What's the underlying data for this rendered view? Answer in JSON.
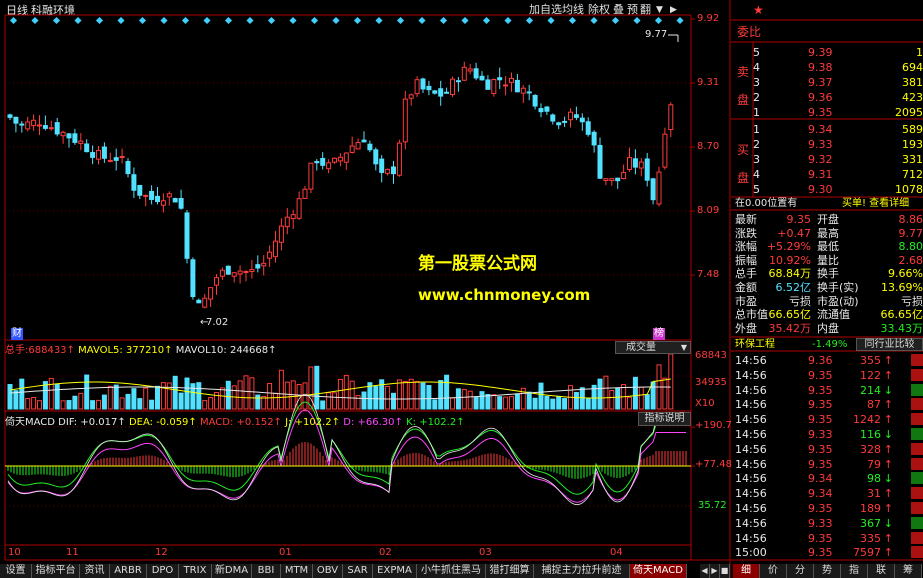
{
  "chart_header": {
    "period": "日线",
    "stock_name": "科融环境"
  },
  "toolbar": {
    "buttons": [
      "加自选",
      "均线",
      "除权",
      "叠",
      "预",
      "翻"
    ],
    "arrow_down": "▼",
    "arrow_right": "▶"
  },
  "price_axis": [
    "9.92",
    "9.31",
    "8.70",
    "8.09",
    "7.48"
  ],
  "marks": {
    "high": "9.77",
    "low": "7.02",
    "cai_badge": "财",
    "tan_badge": "榜"
  },
  "watermark": {
    "line1": "第一股票公式网",
    "line2": "www.chnmoney.com"
  },
  "volume_header": {
    "label": "总手:",
    "value": "688433↑",
    "ma5_label": "MAVOL5:",
    "ma5": "377210↑",
    "ma10_label": "MAVOL10:",
    "ma10": "244668↑",
    "select": "成交量",
    "select_arrow": "▼"
  },
  "volume_axis": [
    "68843",
    "34935",
    "X10"
  ],
  "macd_header": {
    "name": "倚天MACD",
    "dif_label": "DIF:",
    "dif": "+0.017↑",
    "dea_label": "DEA:",
    "dea": "-0.059↑",
    "macd_label": "MACD:",
    "macd": "+0.152↑",
    "j_label": "J:",
    "j": "+102.2↑",
    "d_label": "D:",
    "d": "+66.30↑",
    "k_label": "K:",
    "k": "+102.2↑",
    "help": "指标说明"
  },
  "macd_axis": [
    "+190.7",
    "+77.48",
    "35.72"
  ],
  "date_axis": [
    "10",
    "11",
    "12",
    "01",
    "02",
    "03",
    "04"
  ],
  "bottom_tabs": [
    "设置",
    "指标平台",
    "资讯",
    "ARBR",
    "DPO",
    "TRIX",
    "新DMA",
    "BBI",
    "MTM",
    "OBV",
    "SAR",
    "EXPMA",
    "小牛抓住黑马",
    "猎打细算",
    "捕捉主力拉升前迹",
    "倚天MACD"
  ],
  "bottom_nav": [
    "◀",
    "▶",
    "■"
  ],
  "right_tabs": [
    "细",
    "价",
    "分",
    "势",
    "指",
    "联",
    "筹"
  ],
  "order_book": {
    "title": "委比",
    "sell_label": "卖盘",
    "buy_label": "买盘",
    "asks": [
      {
        "level": "5",
        "price": "9.39",
        "vol": "1"
      },
      {
        "level": "4",
        "price": "9.38",
        "vol": "694"
      },
      {
        "level": "3",
        "price": "9.37",
        "vol": "381"
      },
      {
        "level": "2",
        "price": "9.36",
        "vol": "423"
      },
      {
        "level": "1",
        "price": "9.35",
        "vol": "2095"
      }
    ],
    "bids": [
      {
        "level": "1",
        "price": "9.34",
        "vol": "589"
      },
      {
        "level": "2",
        "price": "9.33",
        "vol": "193"
      },
      {
        "level": "3",
        "price": "9.32",
        "vol": "331"
      },
      {
        "level": "4",
        "price": "9.31",
        "vol": "712"
      },
      {
        "level": "5",
        "price": "9.30",
        "vol": "1078"
      }
    ]
  },
  "position_bar": {
    "left": "在0.00位置有",
    "right": "买单! 查看详细"
  },
  "quote": [
    {
      "l1": "最新",
      "v1": "9.35",
      "l2": "开盘",
      "v2": "8.86"
    },
    {
      "l1": "涨跌",
      "v1": "+0.47",
      "l2": "最高",
      "v2": "9.77"
    },
    {
      "l1": "涨幅",
      "v1": "+5.29%",
      "l2": "最低",
      "v2": "8.80"
    },
    {
      "l1": "振幅",
      "v1": "10.92%",
      "l2": "量比",
      "v2": "2.68"
    },
    {
      "l1": "总手",
      "v1": "68.84万",
      "l2": "换手",
      "v2": "9.66%"
    },
    {
      "l1": "金额",
      "v1": "6.52亿",
      "l2": "换手(实)",
      "v2": "13.69%"
    },
    {
      "l1": "市盈",
      "v1": "亏损",
      "l2": "市盈(动)",
      "v2": "亏损"
    },
    {
      "l1": "总市值",
      "v1": "66.65亿",
      "l2": "流通值",
      "v2": "66.65亿"
    },
    {
      "l1": "外盘",
      "v1": "35.42万",
      "l2": "内盘",
      "v2": "33.43万"
    }
  ],
  "sector": {
    "name": "环保工程",
    "change": "-1.49%",
    "compare": "同行业比较"
  },
  "ticks": [
    {
      "time": "14:56",
      "price": "9.36",
      "vol": "355",
      "arrow": "↑"
    },
    {
      "time": "14:56",
      "price": "9.35",
      "vol": "122",
      "arrow": "↑"
    },
    {
      "time": "14:56",
      "price": "9.35",
      "vol": "214",
      "arrow": "↓"
    },
    {
      "time": "14:56",
      "price": "9.35",
      "vol": "87",
      "arrow": "↑"
    },
    {
      "time": "14:56",
      "price": "9.35",
      "vol": "1242",
      "arrow": "↑"
    },
    {
      "time": "14:56",
      "price": "9.33",
      "vol": "116",
      "arrow": "↓"
    },
    {
      "time": "14:56",
      "price": "9.35",
      "vol": "328",
      "arrow": "↑"
    },
    {
      "time": "14:56",
      "price": "9.35",
      "vol": "79",
      "arrow": "↑"
    },
    {
      "time": "14:56",
      "price": "9.34",
      "vol": "98",
      "arrow": "↓"
    },
    {
      "time": "14:56",
      "price": "9.34",
      "vol": "31",
      "arrow": "↑"
    },
    {
      "time": "14:56",
      "price": "9.35",
      "vol": "189",
      "arrow": "↑"
    },
    {
      "time": "14:56",
      "price": "9.33",
      "vol": "367",
      "arrow": "↓"
    },
    {
      "time": "14:56",
      "price": "9.35",
      "vol": "335",
      "arrow": "↑"
    },
    {
      "time": "15:00",
      "price": "9.35",
      "vol": "7597",
      "arrow": "↑"
    }
  ],
  "colors": {
    "up": "#ff3b3b",
    "down": "#52e2ff",
    "axis_red": "#b00000",
    "gold": "#ffff00"
  }
}
